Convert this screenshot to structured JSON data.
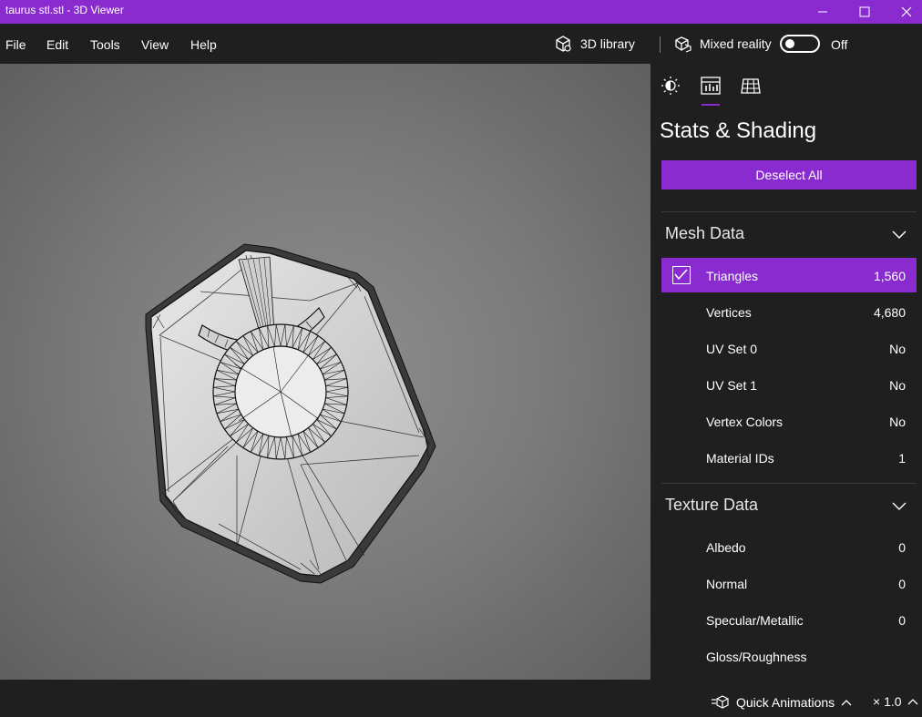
{
  "window": {
    "title": "taurus stl.stl - 3D Viewer"
  },
  "menu": {
    "items": [
      "File",
      "Edit",
      "Tools",
      "View",
      "Help"
    ],
    "library_label": "3D library",
    "mixed_reality_label": "Mixed reality",
    "mixed_reality_state": "Off"
  },
  "panel": {
    "title": "Stats & Shading",
    "deselect_label": "Deselect All",
    "mesh_section": {
      "title": "Mesh Data",
      "rows": [
        {
          "label": "Triangles",
          "value": "1,560",
          "checked": true
        },
        {
          "label": "Vertices",
          "value": "4,680"
        },
        {
          "label": "UV Set 0",
          "value": "No"
        },
        {
          "label": "UV Set 1",
          "value": "No"
        },
        {
          "label": "Vertex Colors",
          "value": "No"
        },
        {
          "label": "Material IDs",
          "value": "1"
        }
      ]
    },
    "texture_section": {
      "title": "Texture Data",
      "rows": [
        {
          "label": "Albedo",
          "value": "0"
        },
        {
          "label": "Normal",
          "value": "0"
        },
        {
          "label": "Specular/Metallic",
          "value": "0"
        },
        {
          "label": "Gloss/Roughness",
          "value": ""
        }
      ]
    }
  },
  "bottom": {
    "quick_animations_label": "Quick Animations",
    "speed_label": "× 1.0"
  },
  "colors": {
    "accent": "#8a2bd0",
    "background": "#1f1f1f"
  }
}
